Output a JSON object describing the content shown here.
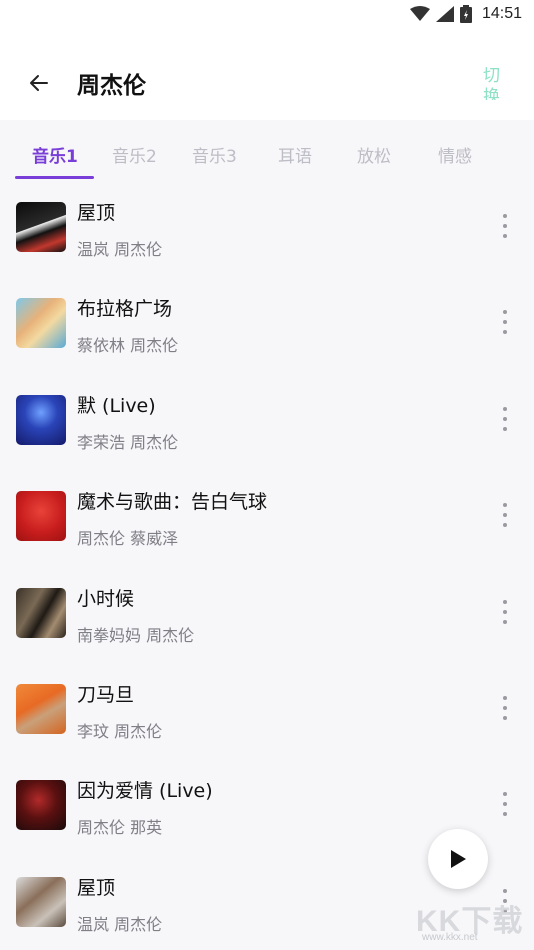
{
  "status_bar": {
    "time": "14:51",
    "icons": [
      "wifi-icon",
      "cellular-signal-icon",
      "battery-icon"
    ]
  },
  "header": {
    "back_icon": "arrow-left-icon",
    "title": "周杰伦",
    "switch_label": "切换"
  },
  "tabs": [
    {
      "label": "音乐1",
      "active": true
    },
    {
      "label": "音乐2",
      "active": false
    },
    {
      "label": "音乐3",
      "active": false
    },
    {
      "label": "耳语",
      "active": false
    },
    {
      "label": "放松",
      "active": false
    },
    {
      "label": "情感",
      "active": false
    }
  ],
  "songs": [
    {
      "title": "屋顶",
      "artist": "温岚 周杰伦"
    },
    {
      "title": "布拉格广场",
      "artist": "蔡依林 周杰伦"
    },
    {
      "title": "默 (Live)",
      "artist": "李荣浩 周杰伦"
    },
    {
      "title": "魔术与歌曲：告白气球",
      "artist": "周杰伦 蔡威泽"
    },
    {
      "title": "小时候",
      "artist": "南拳妈妈 周杰伦"
    },
    {
      "title": "刀马旦",
      "artist": "李玟 周杰伦"
    },
    {
      "title": "因为爱情 (Live)",
      "artist": "周杰伦 那英"
    },
    {
      "title": "屋顶",
      "artist": "温岚 周杰伦"
    }
  ],
  "play_button_icon": "play-icon",
  "watermark": {
    "text": "KK下载",
    "url": "www.kkx.net"
  },
  "colors": {
    "accent": "#7a3ed8",
    "switch_text": "#8ee1c6",
    "inactive_tab": "#bdbdc5",
    "secondary_text": "#7f7f86",
    "background": "#f7f6f9"
  }
}
